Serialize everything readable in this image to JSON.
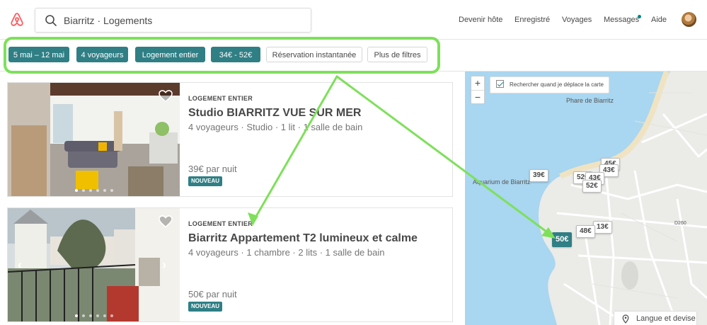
{
  "search": {
    "value": "Biarritz · Logements"
  },
  "nav": {
    "host": "Devenir hôte",
    "saved": "Enregistré",
    "trips": "Voyages",
    "messages": "Messages",
    "help": "Aide"
  },
  "filters": {
    "dates": "5 mai – 12 mai",
    "guests": "4 voyageurs",
    "type": "Logement entier",
    "price": "34€ - 52€",
    "instant": "Réservation instantanée",
    "more": "Plus de filtres"
  },
  "listings": [
    {
      "kind": "LOGEMENT ENTIER",
      "title": "Studio BIARRITZ VUE SUR MER",
      "meta": "4 voyageurs · Studio · 1 lit · 1 salle de bain",
      "price": "39€ par nuit",
      "badge": "NOUVEAU"
    },
    {
      "kind": "LOGEMENT ENTIER",
      "title": "Biarritz Appartement T2 lumineux et calme",
      "meta": "4 voyageurs · 1 chambre · 2 lits · 1 salle de bain",
      "price": "50€ par nuit",
      "badge": "NOUVEAU"
    }
  ],
  "map": {
    "zoom_in": "+",
    "zoom_out": "−",
    "search_on_move": "Rechercher quand je déplace la carte",
    "labels": {
      "lighthouse": "Phare de Biarritz",
      "aquarium": "Aquarium de Biarritz",
      "road": "D260"
    },
    "pins": [
      "45€",
      "43€",
      "39€",
      "52€",
      "43€",
      "52€",
      "13€",
      "48€",
      "50€"
    ],
    "selected_pin": "50€"
  },
  "language": "Langue et devise",
  "colors": {
    "accent": "#2f7f85",
    "brand": "#ff5a5f",
    "annotation": "#7ee05a"
  }
}
